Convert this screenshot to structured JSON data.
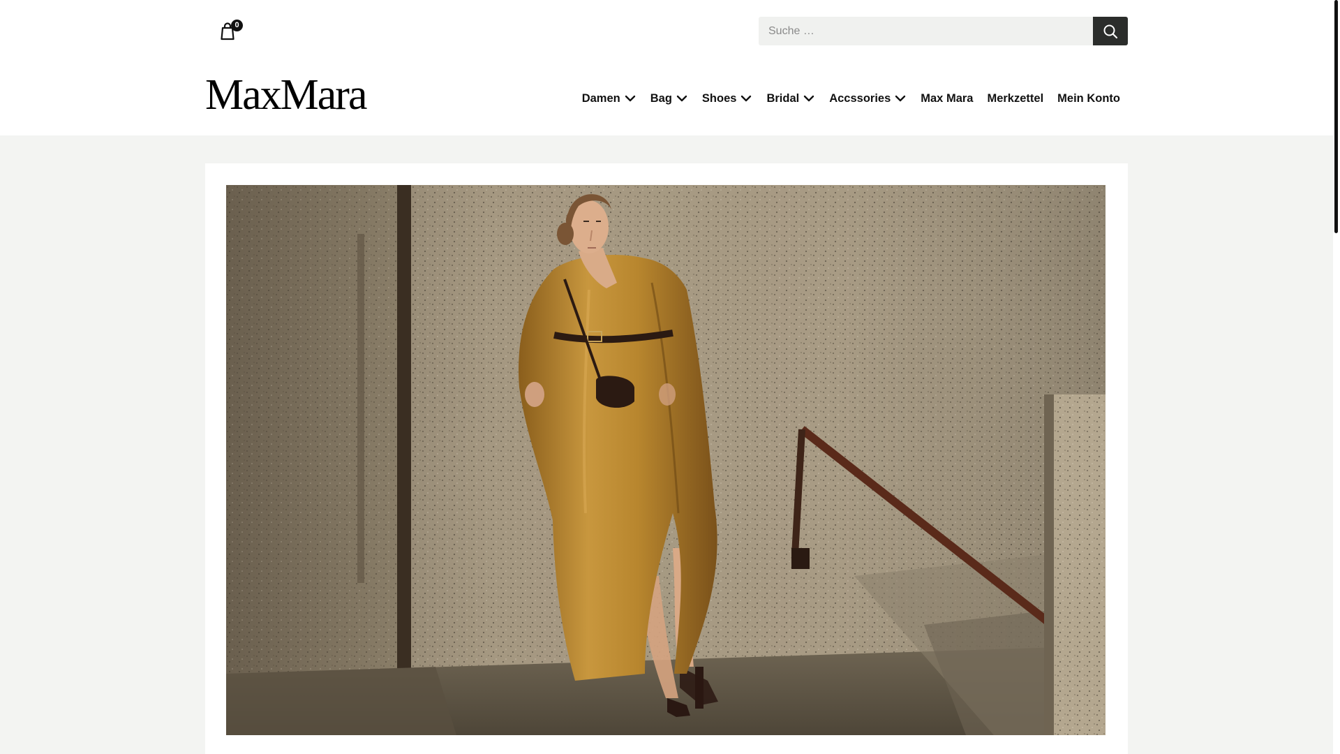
{
  "header": {
    "cart": {
      "count": "0",
      "icon": "shopping-bag-icon"
    },
    "search": {
      "placeholder": "Suche …",
      "value": "",
      "button_icon": "search-icon"
    },
    "logo": "MaxMara"
  },
  "nav": {
    "items": [
      {
        "label": "Damen",
        "has_dropdown": true
      },
      {
        "label": "Bag",
        "has_dropdown": true
      },
      {
        "label": "Shoes",
        "has_dropdown": true
      },
      {
        "label": "Bridal",
        "has_dropdown": true
      },
      {
        "label": "Accssories",
        "has_dropdown": true
      },
      {
        "label": "Max Mara",
        "has_dropdown": false
      },
      {
        "label": "Merkzettel",
        "has_dropdown": false
      },
      {
        "label": "Mein Konto",
        "has_dropdown": false
      }
    ]
  },
  "colors": {
    "page_background": "#f3f4f2",
    "header_background": "#ffffff",
    "search_button": "#2b2d2b",
    "coat": "#b8862e",
    "wall": "#a89a82"
  }
}
